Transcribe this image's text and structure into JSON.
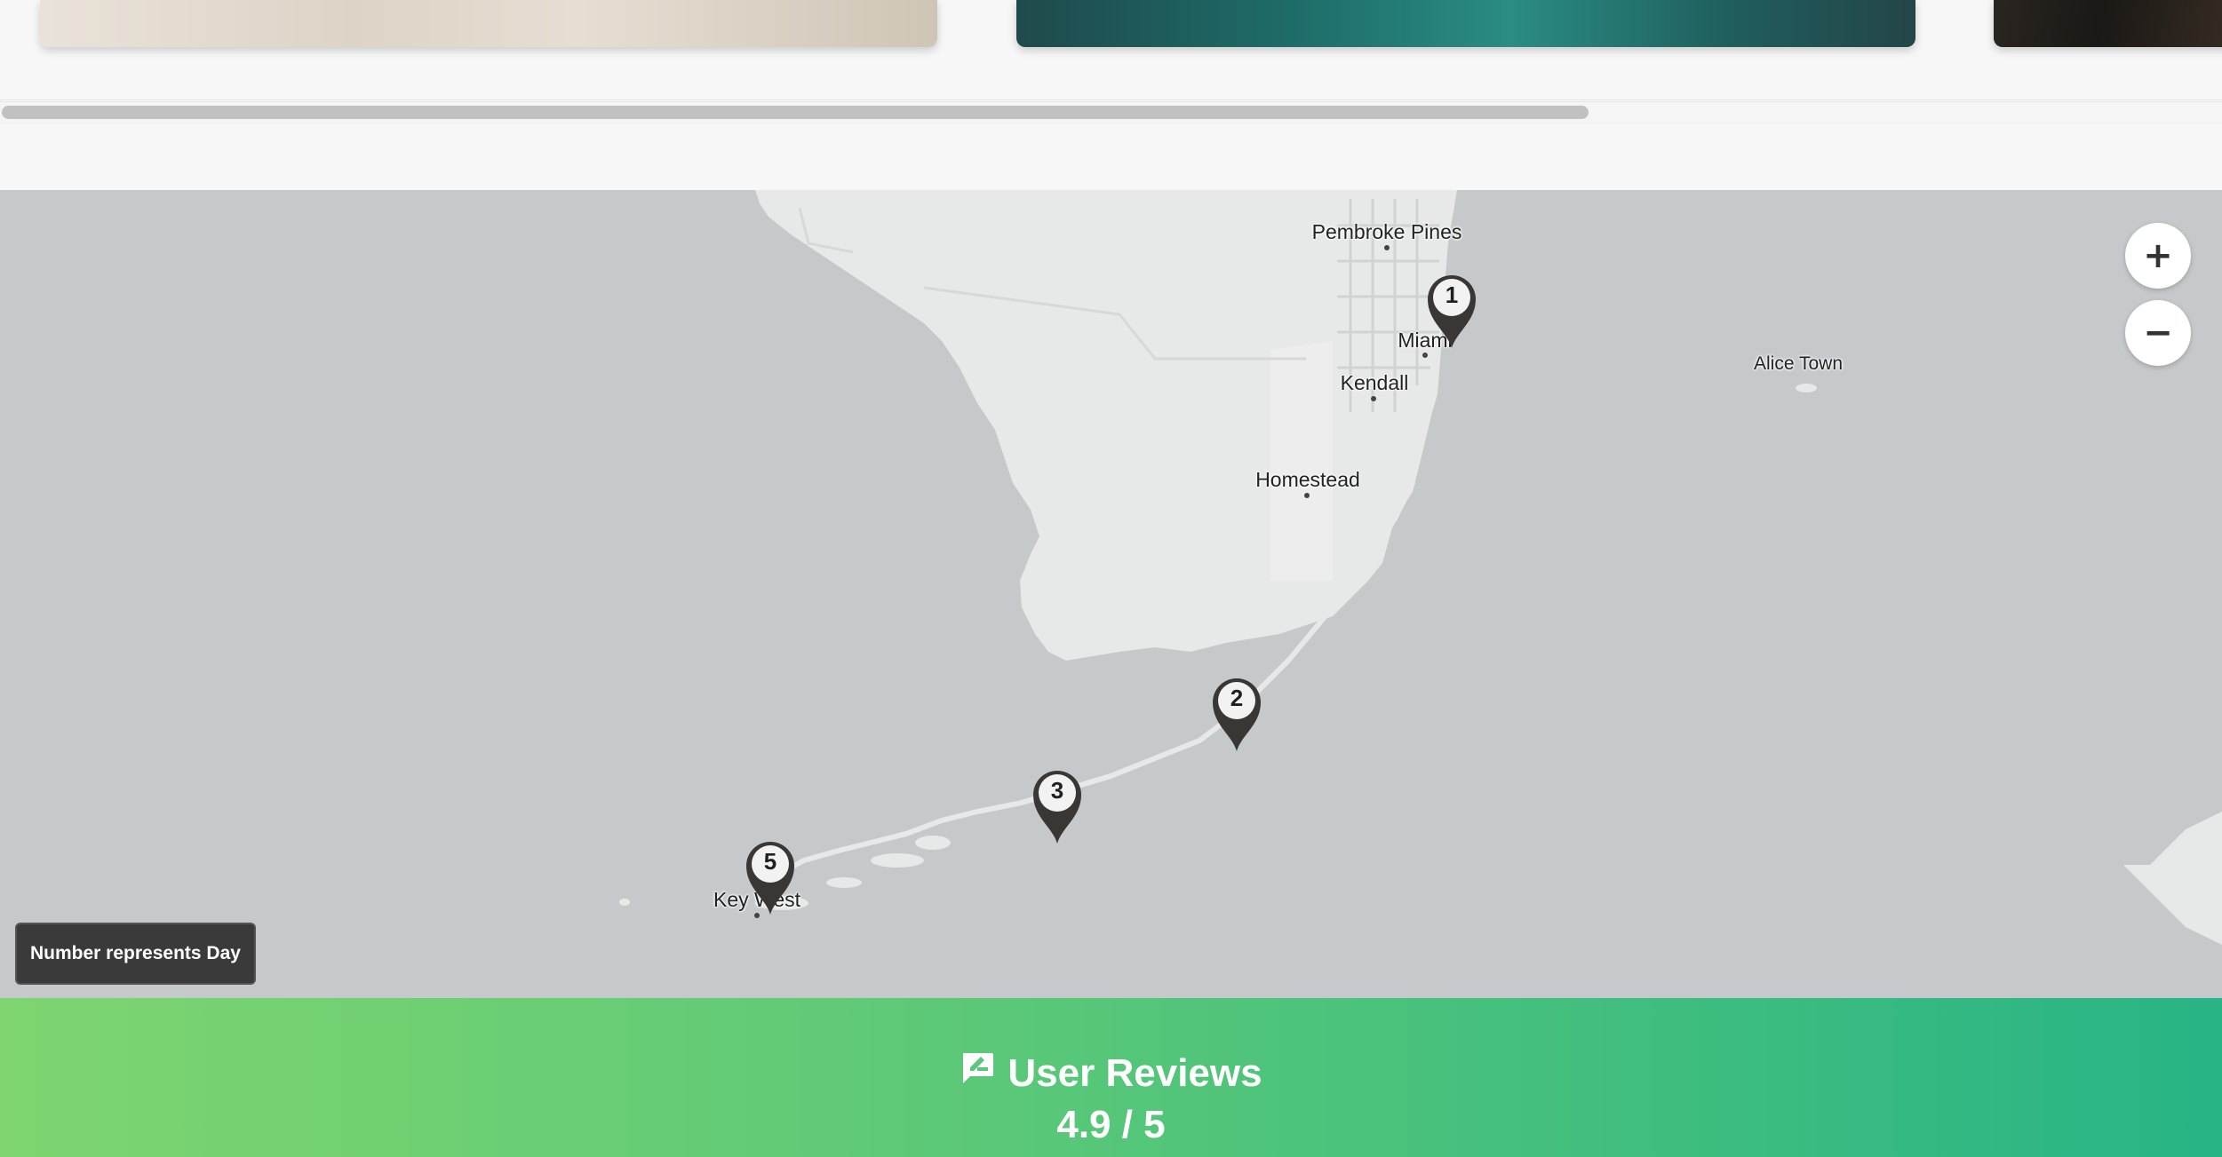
{
  "map": {
    "places": [
      {
        "name": "Pembroke Pines"
      },
      {
        "name": "Miami"
      },
      {
        "name": "Kendall"
      },
      {
        "name": "Homestead"
      },
      {
        "name": "Alice Town"
      },
      {
        "name": "Key West"
      }
    ],
    "markers": [
      {
        "label": "1"
      },
      {
        "label": "2"
      },
      {
        "label": "3"
      },
      {
        "label": "5"
      }
    ],
    "zoom_in_label": "+",
    "zoom_out_label": "−",
    "legend": "Number represents Day"
  },
  "reviews": {
    "title": "User Reviews",
    "score": "4.9 / 5",
    "icon": "review-icon"
  },
  "colors": {
    "water": "#c5c9cb",
    "land": "#e7e8e8",
    "marker": "#3a3633",
    "banner_start": "#7ed56f",
    "banner_end": "#28b485"
  }
}
